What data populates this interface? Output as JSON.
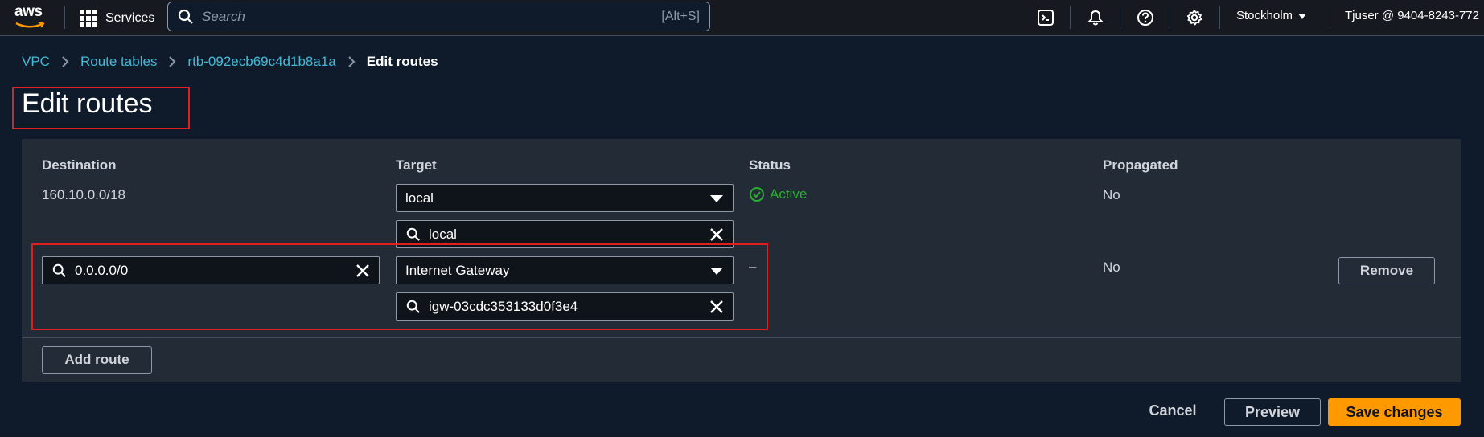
{
  "nav": {
    "logo": "aws",
    "services_label": "Services",
    "search_placeholder": "Search",
    "search_shortcut": "[Alt+S]",
    "region": "Stockholm",
    "account": "Tjuser @ 9404-8243-772"
  },
  "breadcrumb": {
    "items": [
      "VPC",
      "Route tables",
      "rtb-092ecb69c4d1b8a1a"
    ],
    "current": "Edit routes"
  },
  "page_title": "Edit routes",
  "table": {
    "headers": {
      "destination": "Destination",
      "target": "Target",
      "status": "Status",
      "propagated": "Propagated"
    },
    "rows": [
      {
        "destination": "160.10.0.0/18",
        "target": "local",
        "target_search": "local",
        "status": "Active",
        "propagated": "No"
      },
      {
        "destination": "0.0.0.0/0",
        "target": "Internet Gateway",
        "target_search": "igw-03cdc353133d0f3e4",
        "status": "–",
        "propagated": "No",
        "remove_label": "Remove"
      }
    ],
    "add_route_label": "Add route"
  },
  "footer": {
    "cancel": "Cancel",
    "preview": "Preview",
    "save": "Save changes"
  },
  "colors": {
    "accent": "#ff9900",
    "link": "#44b9d6",
    "success": "#29ad32",
    "highlight_border": "#e02020"
  }
}
